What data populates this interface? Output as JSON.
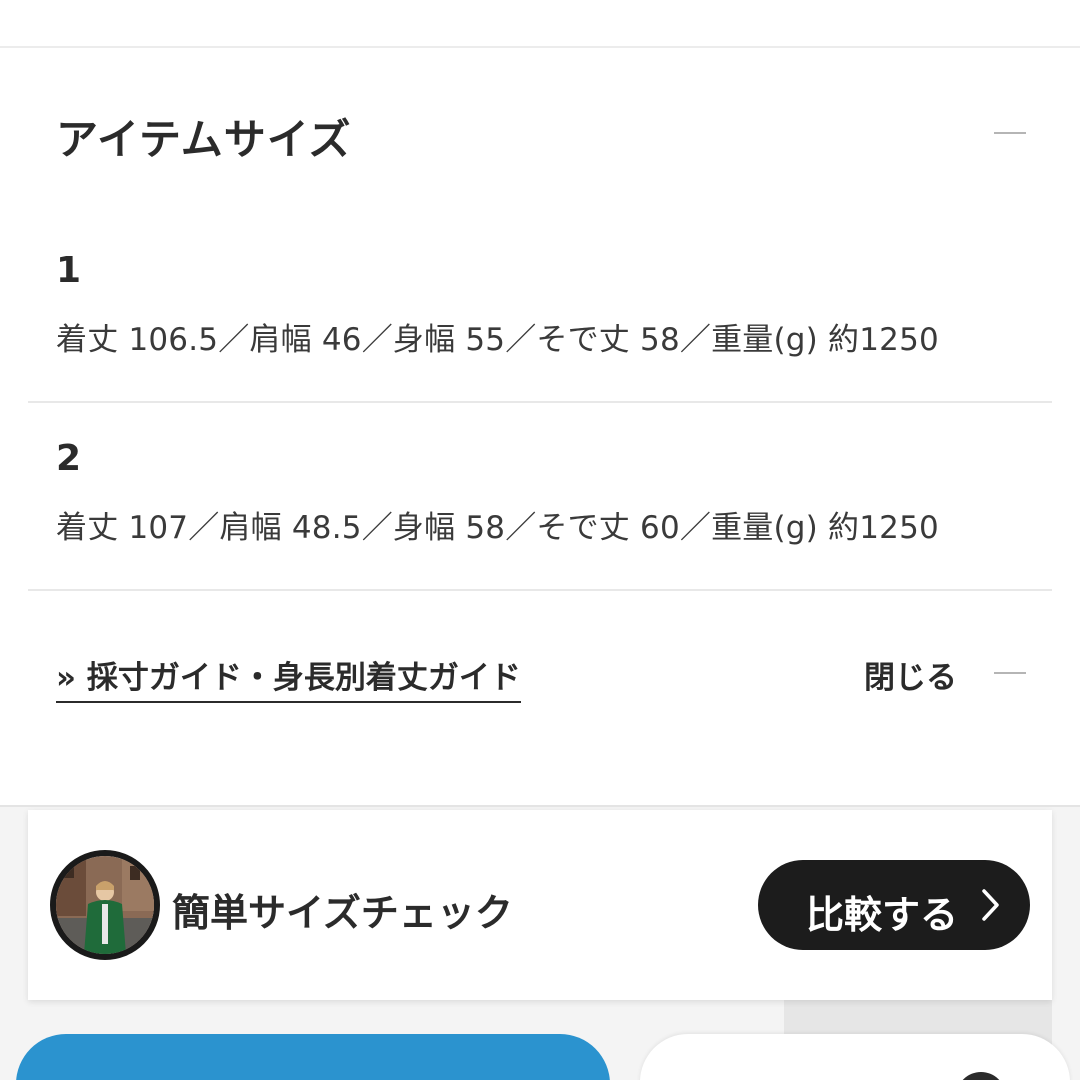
{
  "item_size": {
    "title": "アイテムサイズ",
    "rows": [
      {
        "label": "1",
        "detail": "着丈 106.5／肩幅 46／身幅 55／そで丈 58／重量(g) 約1250"
      },
      {
        "label": "2",
        "detail": "着丈 107／肩幅 48.5／身幅 58／そで丈 60／重量(g) 約1250"
      }
    ],
    "guide_link": "» 採寸ガイド・身長別着丈ガイド",
    "close_label": "閉じる"
  },
  "size_check": {
    "title": "簡単サイズチェック",
    "compare_label": "比較する",
    "chevron_icon": "chevron-right-icon"
  },
  "colors": {
    "accent_blue": "#2b93cf",
    "dark_button": "#1c1c1c",
    "text": "#2b2b2b"
  }
}
